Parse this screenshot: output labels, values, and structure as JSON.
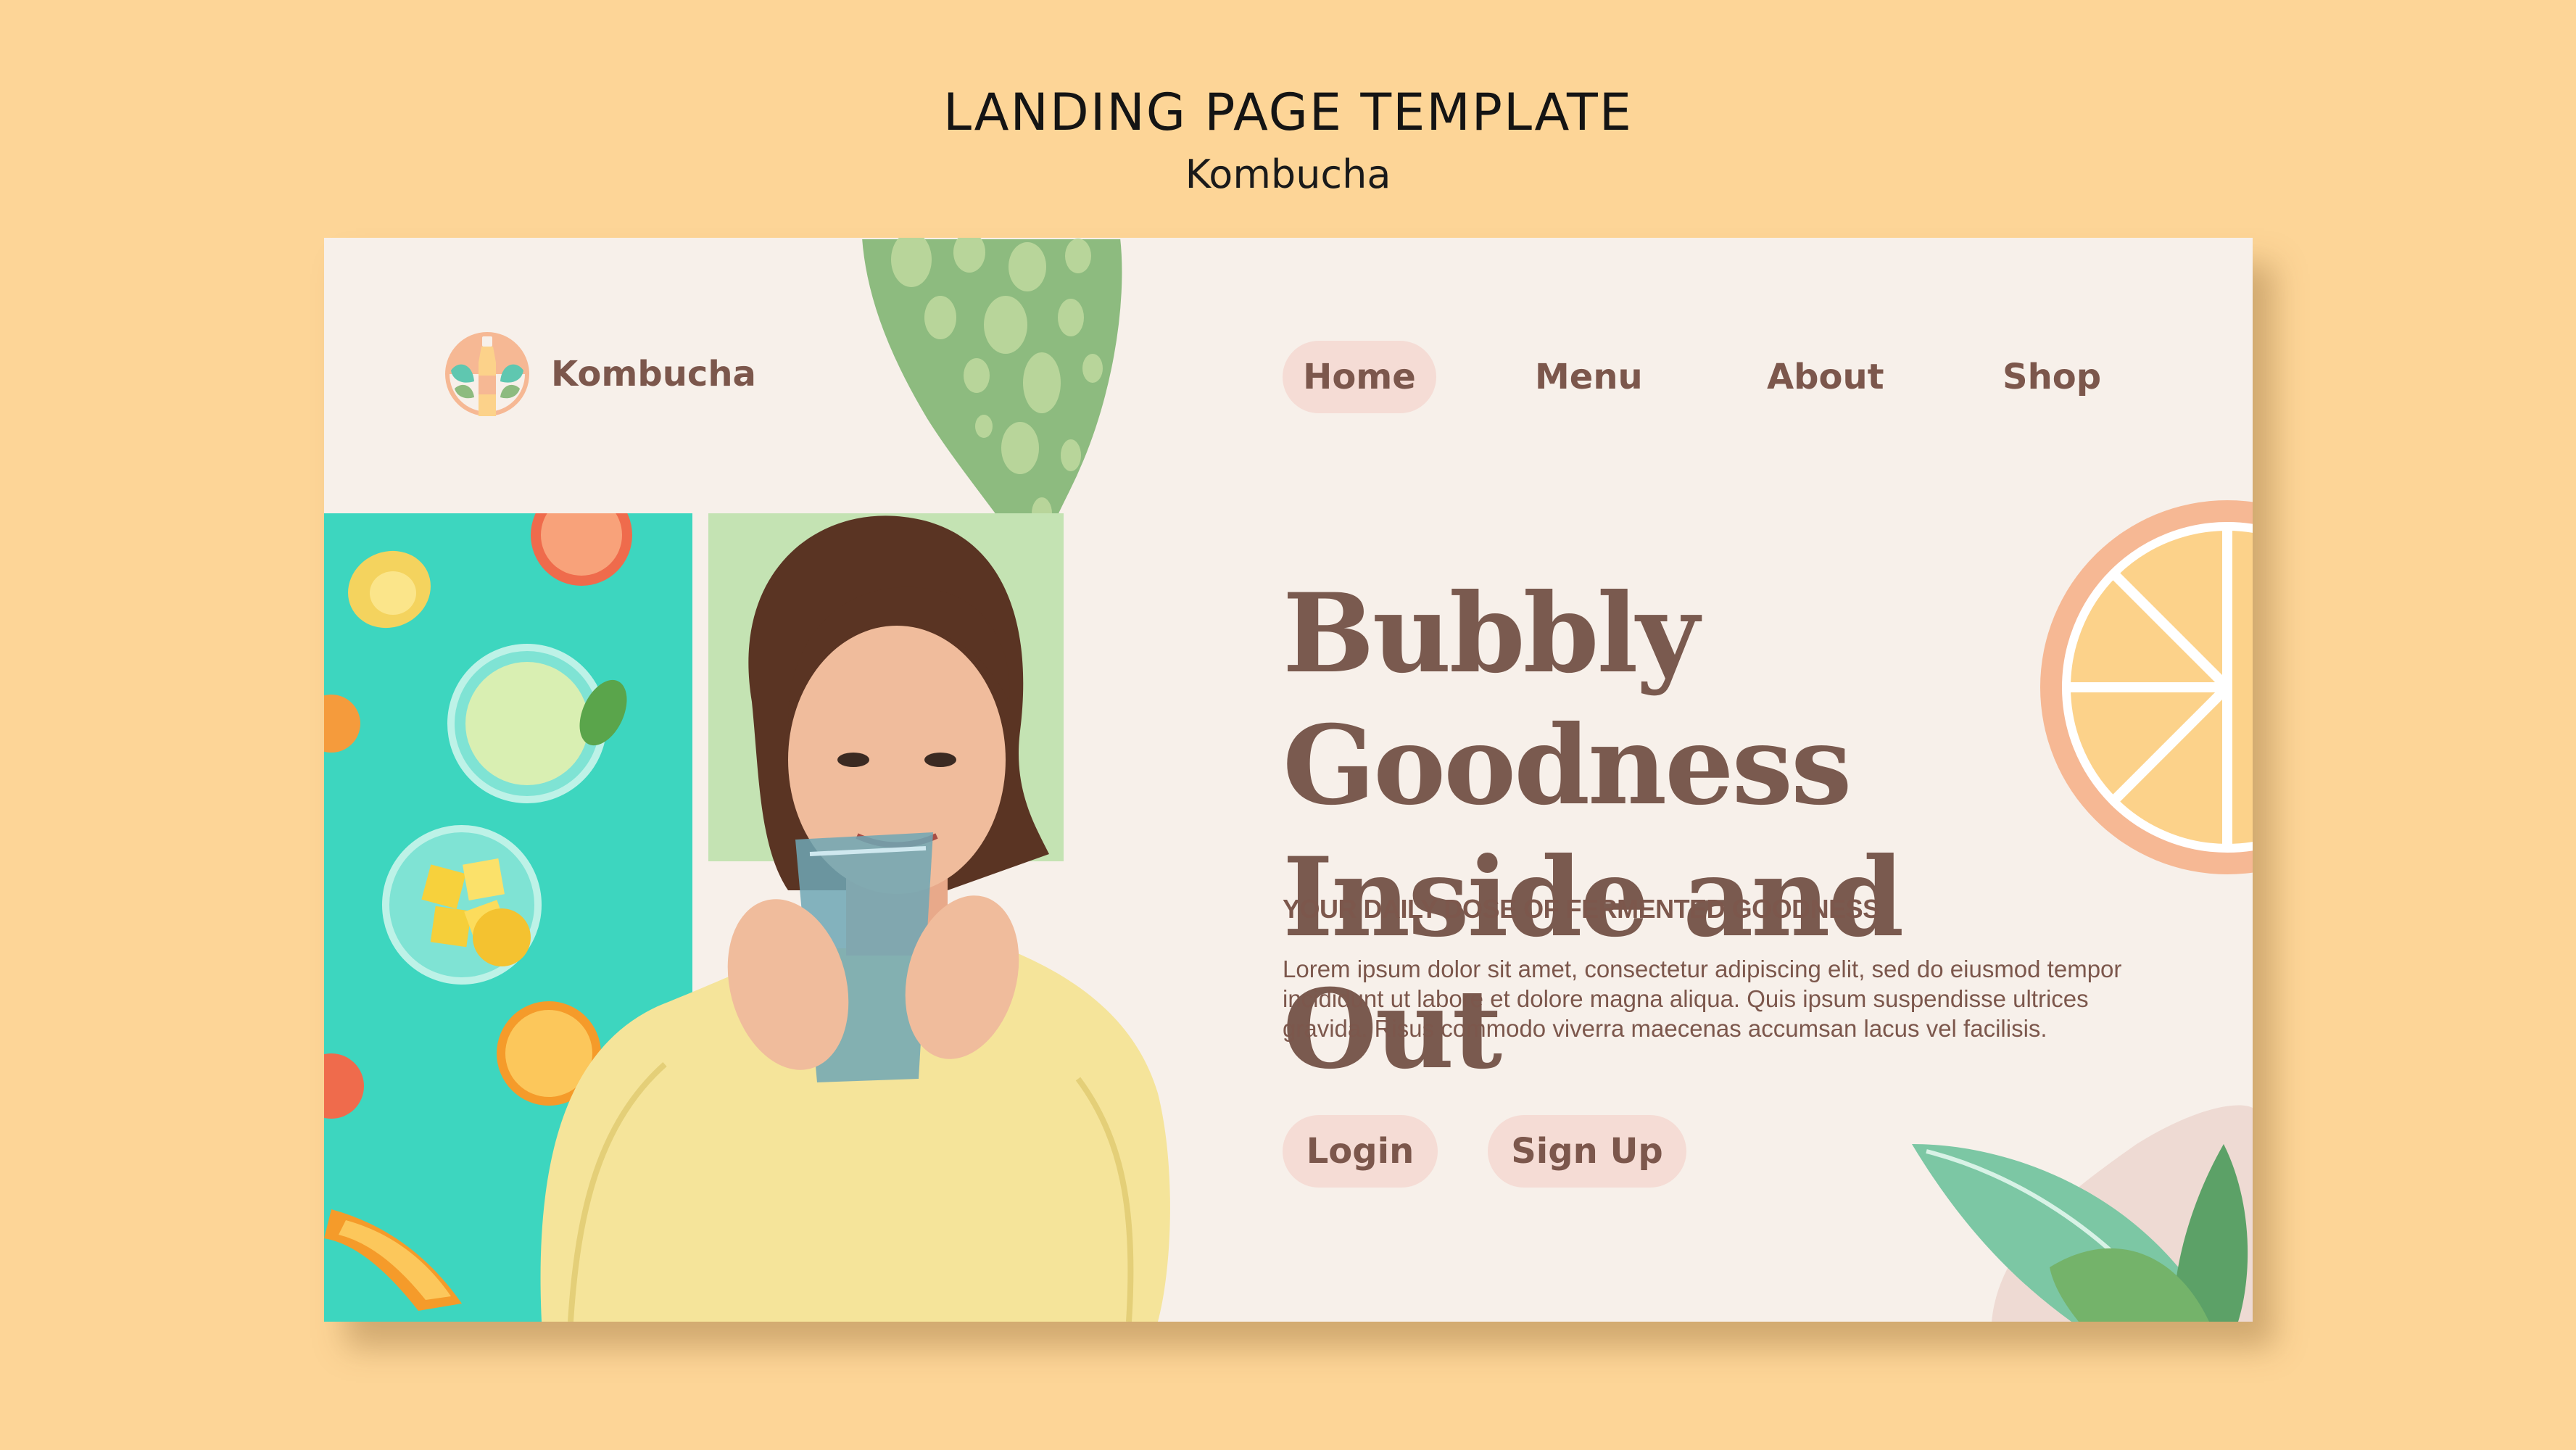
{
  "page": {
    "title": "LANDING PAGE TEMPLATE",
    "subtitle": "Kombucha"
  },
  "site": {
    "brand": "Kombucha",
    "nav": [
      "Home",
      "Menu",
      "About",
      "Shop"
    ],
    "active_nav": "Home",
    "hero": {
      "headline_line1": "Bubbly Goodness",
      "headline_line2": "Inside and Out",
      "tagline": "YOUR DAILY DOSE OF FERMENTED GOODNESS",
      "body": "Lorem ipsum dolor sit amet, consectetur adipiscing elit, sed do eiusmod tempor incididunt ut labore et dolore magna aliqua. Quis ipsum suspendisse ultrices gravida. Risus commodo viverra maecenas accumsan lacus vel facilisis."
    },
    "buttons": {
      "login": "Login",
      "signup": "Sign Up"
    }
  },
  "colors": {
    "background": "#fdd597",
    "card": "#f7f0ea",
    "brown": "#7c574c",
    "pill": "#f5dcd5",
    "teal": "#3dd6bf",
    "leaf_green": "#8dbb7f",
    "orange_peel": "#f6b894",
    "orange_flesh": "#fcd28a",
    "sweater": "#f5e49a"
  }
}
